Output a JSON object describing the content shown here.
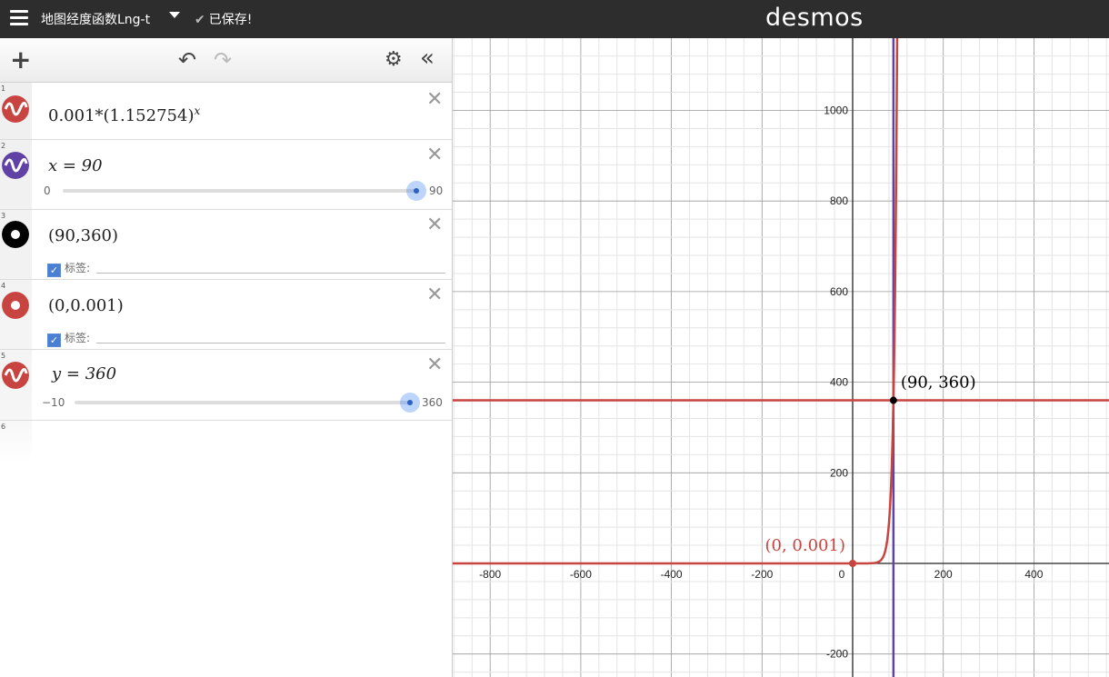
{
  "topbar": {
    "graph_title": "地图经度函数Lng-t",
    "saved_status": "已保存!",
    "brand": "desmos"
  },
  "toolbar": {
    "add_icon": "plus-icon",
    "undo_icon": "undo-icon",
    "redo_icon": "redo-icon",
    "settings_icon": "gear-icon",
    "collapse_icon": "double-chevron-left-icon"
  },
  "expressions": [
    {
      "num": "1",
      "latex": "0.001*(1.152754)",
      "sup": "x",
      "color": "#c74440",
      "icon": "curve-icon"
    },
    {
      "num": "2",
      "latex": "x = 90",
      "color": "#6042a6",
      "icon": "curve-icon",
      "slider": {
        "min": "0",
        "max": "90",
        "fraction": 1.0
      }
    },
    {
      "num": "3",
      "latex": "(90,360)",
      "color": "#000000",
      "icon": "point-icon",
      "label_prefix": "标签:"
    },
    {
      "num": "4",
      "latex": "(0,0.001)",
      "color": "#c74440",
      "icon": "point-icon",
      "label_prefix": "标签:"
    },
    {
      "num": "5",
      "latex": "y = 360",
      "color": "#c74440",
      "icon": "curve-icon",
      "slider": {
        "min": "−10",
        "max": "360",
        "fraction": 1.0
      }
    },
    {
      "num": "6"
    }
  ],
  "graph": {
    "x_ticks": [
      "-800",
      "-600",
      "-400",
      "-200",
      "0",
      "200",
      "400"
    ],
    "y_ticks": [
      "1000",
      "800",
      "600",
      "400",
      "200",
      "-200"
    ],
    "point_labels": [
      "(90, 360)",
      "(0, 0.001)"
    ],
    "colors": {
      "red": "#c74440",
      "purple": "#6042a6",
      "black": "#000000"
    }
  }
}
